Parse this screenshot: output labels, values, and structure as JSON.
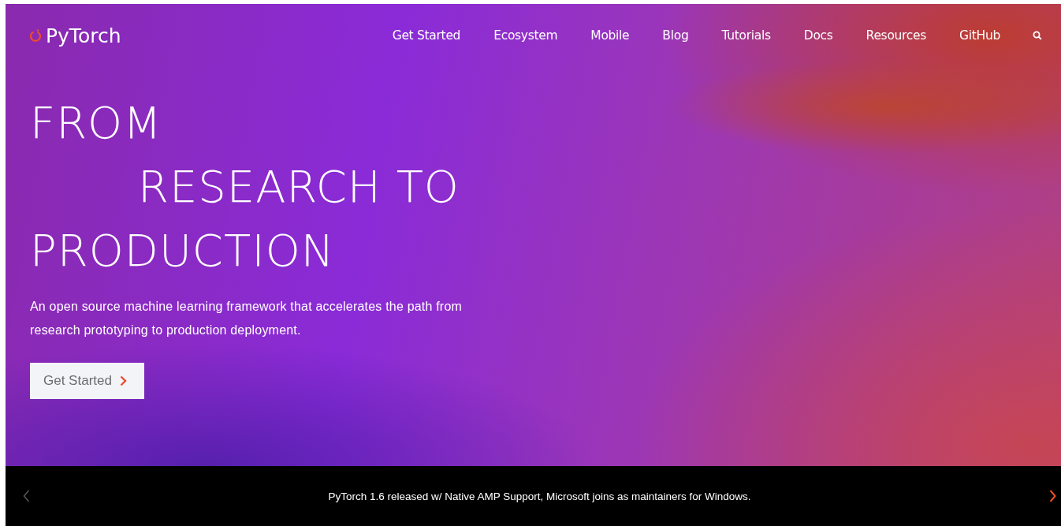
{
  "header": {
    "logo": "PyTorch",
    "nav": [
      {
        "label": "Get Started"
      },
      {
        "label": "Ecosystem"
      },
      {
        "label": "Mobile"
      },
      {
        "label": "Blog"
      },
      {
        "label": "Tutorials"
      },
      {
        "label": "Docs"
      },
      {
        "label": "Resources"
      },
      {
        "label": "GitHub"
      }
    ]
  },
  "hero": {
    "headline": [
      {
        "text": "FROM",
        "kind": "flush"
      },
      {
        "text": "RESEARCH TO",
        "kind": "indented"
      },
      {
        "text": "PRODUCTION",
        "kind": "flush"
      }
    ],
    "description": "An open source machine learning framework that accelerates the path from research prototyping to production deployment.",
    "button": "Get Started"
  },
  "announcement": {
    "text": "PyTorch 1.6 released w/ Native AMP Support, Microsoft joins as maintainers for Windows.",
    "prev_disabled": true,
    "next_disabled": false
  }
}
